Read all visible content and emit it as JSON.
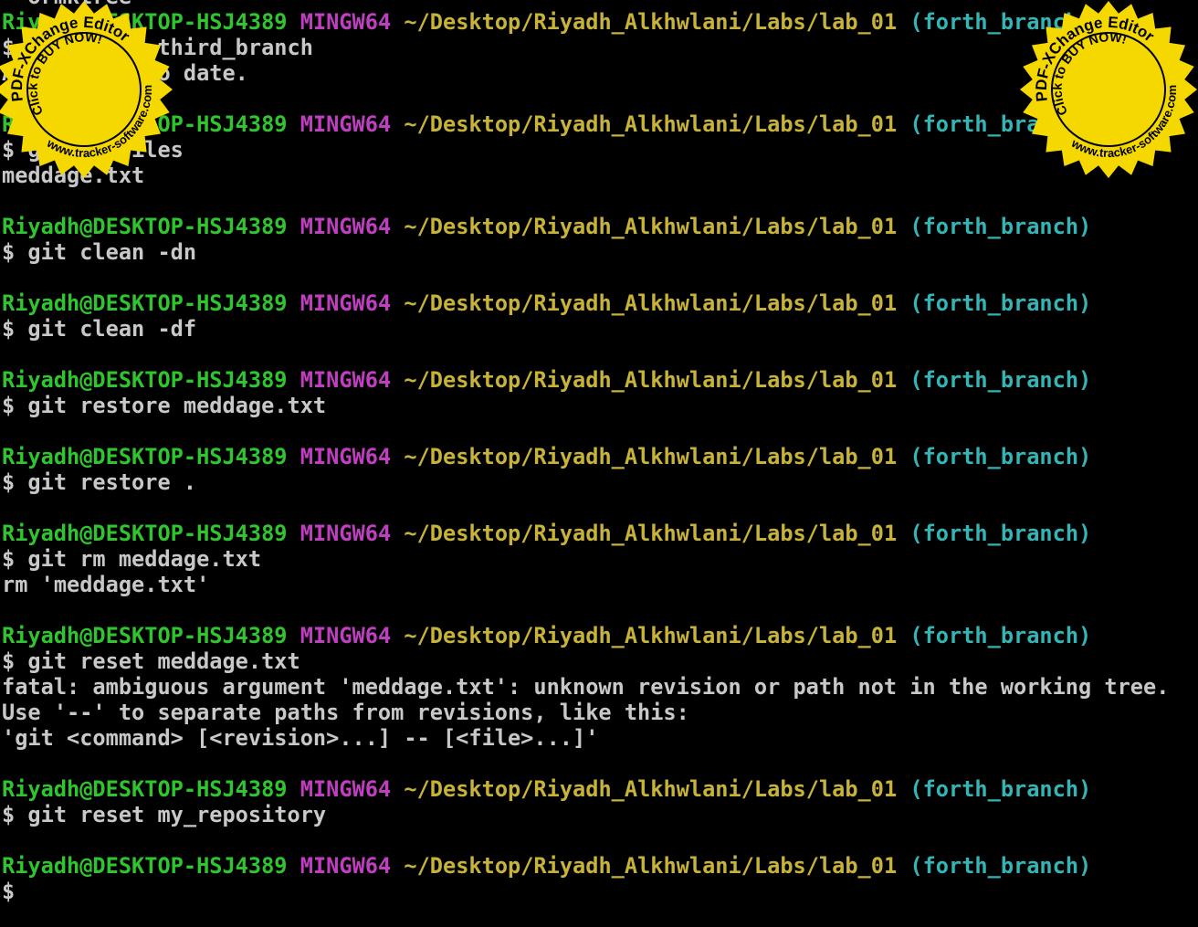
{
  "prompt": {
    "user_host": "Riyadh@DESKTOP-HSJ4389",
    "system": "MINGW64",
    "path": "~/Desktop/Riyadh_Alkhwlani/Labs/lab_01",
    "branch": "(forth_branch)"
  },
  "lines": [
    {
      "type": "output",
      "text": "  ormktree"
    },
    {
      "type": "prompt"
    },
    {
      "type": "command",
      "text": "$ git merge third_branch"
    },
    {
      "type": "output",
      "text": "Already up to date."
    },
    {
      "type": "blank"
    },
    {
      "type": "prompt"
    },
    {
      "type": "command",
      "text": "$ git ls-files"
    },
    {
      "type": "output",
      "text": "meddage.txt"
    },
    {
      "type": "blank"
    },
    {
      "type": "prompt"
    },
    {
      "type": "command",
      "text": "$ git clean -dn"
    },
    {
      "type": "blank"
    },
    {
      "type": "prompt"
    },
    {
      "type": "command",
      "text": "$ git clean -df"
    },
    {
      "type": "blank"
    },
    {
      "type": "prompt"
    },
    {
      "type": "command",
      "text": "$ git restore meddage.txt"
    },
    {
      "type": "blank"
    },
    {
      "type": "prompt"
    },
    {
      "type": "command",
      "text": "$ git restore ."
    },
    {
      "type": "blank"
    },
    {
      "type": "prompt"
    },
    {
      "type": "command",
      "text": "$ git rm meddage.txt"
    },
    {
      "type": "output",
      "text": "rm 'meddage.txt'"
    },
    {
      "type": "blank"
    },
    {
      "type": "prompt"
    },
    {
      "type": "command",
      "text": "$ git reset meddage.txt"
    },
    {
      "type": "output",
      "text": "fatal: ambiguous argument 'meddage.txt': unknown revision or path not in the working tree."
    },
    {
      "type": "output",
      "text": "Use '--' to separate paths from revisions, like this:"
    },
    {
      "type": "output",
      "text": "'git <command> [<revision>...] -- [<file>...]'"
    },
    {
      "type": "blank"
    },
    {
      "type": "prompt"
    },
    {
      "type": "command",
      "text": "$ git reset my_repository"
    },
    {
      "type": "blank"
    },
    {
      "type": "prompt"
    },
    {
      "type": "command",
      "text": "$"
    }
  ],
  "watermark": {
    "top": "PDF-XChange Editor",
    "middle": "Click to BUY NOW!",
    "bottom": "www.tracker-software.com",
    "fill_color": "#f5d800",
    "text_color": "#000000"
  },
  "colors": {
    "background": "#000000",
    "text": "#c8c8c8",
    "user_host": "#2fc52f",
    "system": "#c03ec0",
    "path": "#c7b23a",
    "branch": "#34b5b5"
  }
}
